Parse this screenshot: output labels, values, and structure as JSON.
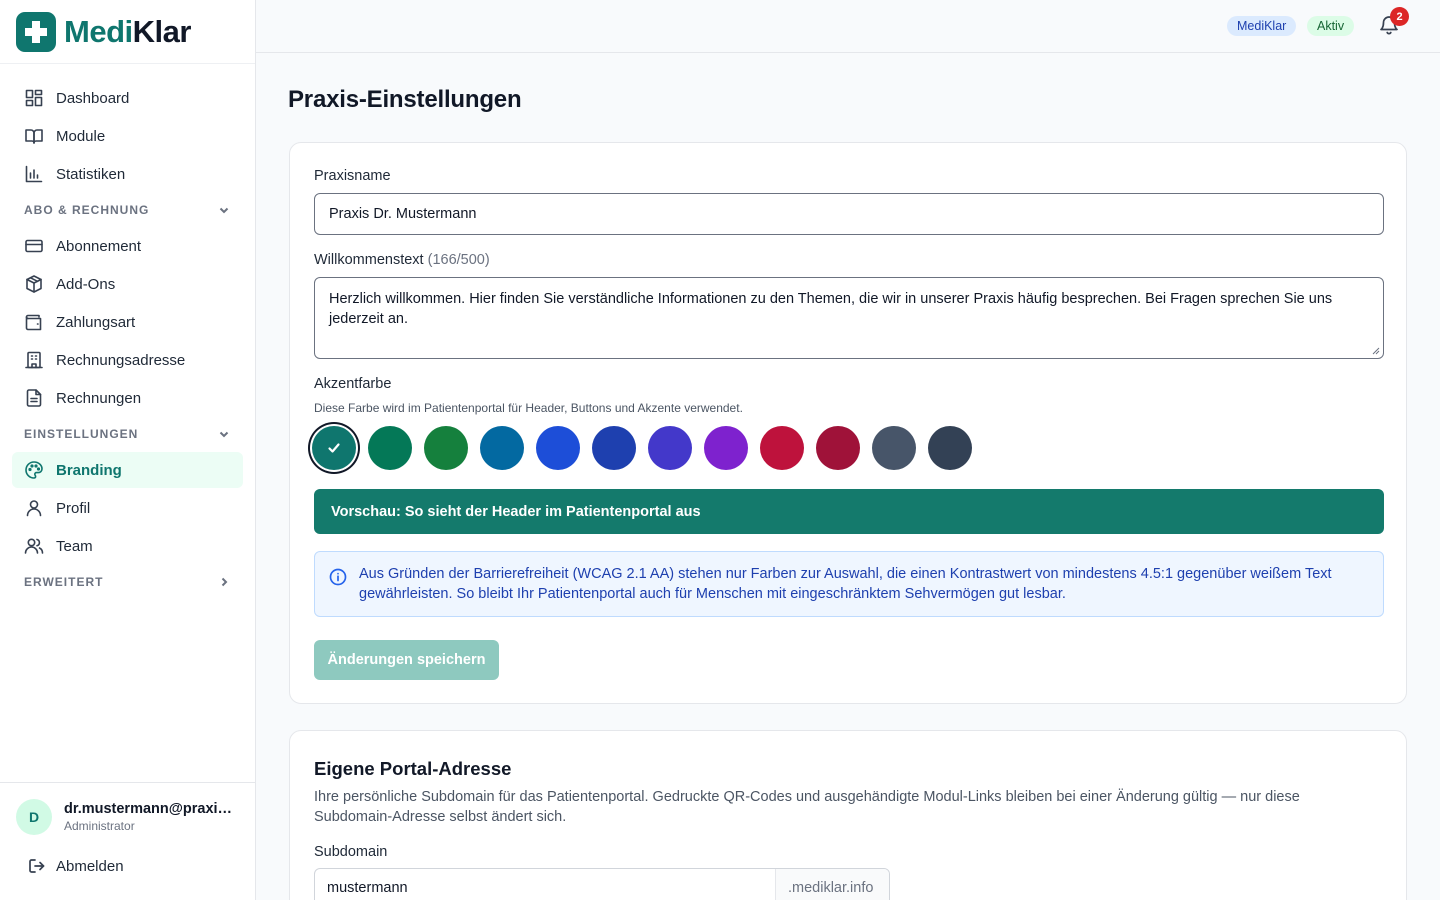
{
  "brand": {
    "name_part1": "Medi",
    "name_part2": "Klar",
    "accent": "#0f766e"
  },
  "sidebar": {
    "top_items": [
      {
        "label": "Dashboard",
        "icon": "grid-icon"
      },
      {
        "label": "Module",
        "icon": "book-icon"
      },
      {
        "label": "Statistiken",
        "icon": "bar-chart-icon"
      }
    ],
    "sections": [
      {
        "title": "ABO & RECHNUNG",
        "expanded": true,
        "items": [
          {
            "label": "Abonnement",
            "icon": "credit-card-icon"
          },
          {
            "label": "Add-Ons",
            "icon": "package-icon"
          },
          {
            "label": "Zahlungsart",
            "icon": "wallet-icon"
          },
          {
            "label": "Rechnungsadresse",
            "icon": "building-icon"
          },
          {
            "label": "Rechnungen",
            "icon": "file-text-icon"
          }
        ]
      },
      {
        "title": "EINSTELLUNGEN",
        "expanded": true,
        "items": [
          {
            "label": "Branding",
            "icon": "palette-icon",
            "active": true
          },
          {
            "label": "Profil",
            "icon": "user-icon"
          },
          {
            "label": "Team",
            "icon": "users-icon"
          }
        ]
      },
      {
        "title": "ERWEITERT",
        "expanded": false,
        "items": []
      }
    ],
    "user": {
      "initial": "D",
      "email": "dr.mustermann@praxis...",
      "role": "Administrator"
    },
    "logout_label": "Abmelden"
  },
  "topbar": {
    "app_badge": "MediKlar",
    "status_badge": "Aktiv",
    "notification_count": "2"
  },
  "main": {
    "title": "Praxis-Einstellungen",
    "branding": {
      "practice_name_label": "Praxisname",
      "practice_name_value": "Praxis Dr. Mustermann",
      "welcome_label": "Willkommenstext",
      "welcome_counter": "(166/500)",
      "welcome_value": "Herzlich willkommen. Hier finden Sie verständliche Informationen zu den Themen, die wir in unserer Praxis häufig besprechen. Bei Fragen sprechen Sie uns jederzeit an.",
      "accent_label": "Akzentfarbe",
      "accent_hint": "Diese Farbe wird im Patientenportal für Header, Buttons und Akzente verwendet.",
      "colors": [
        "#0f766e",
        "#047857",
        "#15803d",
        "#0369a1",
        "#1d4ed8",
        "#1e40af",
        "#4338ca",
        "#7e22ce",
        "#be123c",
        "#9f1239",
        "#475569",
        "#334155"
      ],
      "selected_color_index": 0,
      "preview_text": "Vorschau: So sieht der Header im Patientenportal aus",
      "preview_color": "#147a6c",
      "info_text": "Aus Gründen der Barrierefreiheit (WCAG 2.1 AA) stehen nur Farben zur Auswahl, die einen Kontrastwert von mindestens 4.5:1 gegenüber weißem Text gewährleisten. So bleibt Ihr Patientenportal auch für Menschen mit eingeschränktem Sehvermögen gut lesbar.",
      "save_label": "Änderungen speichern"
    },
    "portal": {
      "title": "Eigene Portal-Adresse",
      "description": "Ihre persönliche Subdomain für das Patientenportal. Gedruckte QR-Codes und ausgehändigte Modul-Links bleiben bei einer Änderung gültig — nur diese Subdomain-Adresse selbst ändert sich.",
      "subdomain_label": "Subdomain",
      "subdomain_value": "mustermann",
      "subdomain_suffix": ".mediklar.info"
    }
  }
}
